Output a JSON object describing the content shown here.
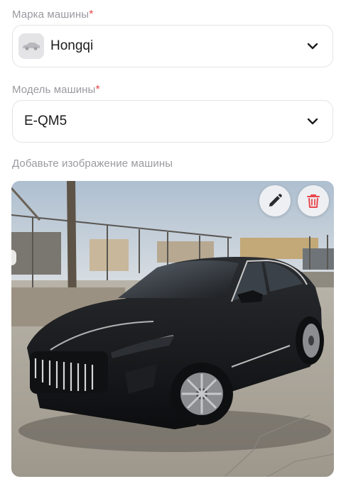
{
  "brand": {
    "label": "Марка машины",
    "required_mark": "*",
    "value": "Hongqi",
    "icon": "car-thumbnail-icon"
  },
  "model": {
    "label": "Модель машины",
    "required_mark": "*",
    "value": "E-QM5"
  },
  "image_section": {
    "label": "Добавьте изображение машины",
    "edit_icon": "pencil-icon",
    "delete_icon": "trash-icon"
  },
  "colors": {
    "required": "#e8474b",
    "label": "#9a9aa0",
    "delete_icon": "#e8474b",
    "text": "#1d1d1f"
  }
}
